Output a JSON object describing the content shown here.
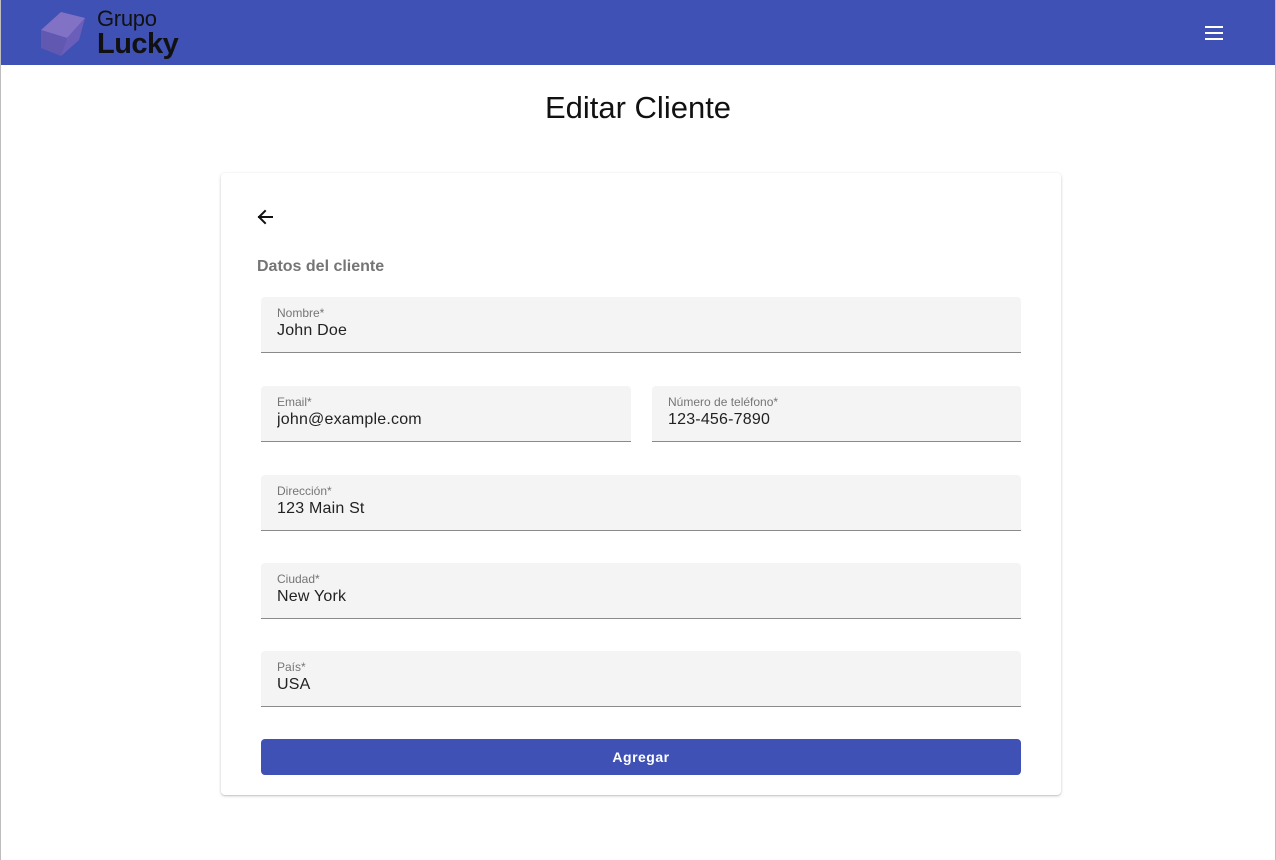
{
  "header": {
    "logo_line1": "Grupo",
    "logo_line2": "Lucky",
    "menu_icon": "menu-icon",
    "bar_color": "#3f51b5"
  },
  "page": {
    "title": "Editar Cliente"
  },
  "form": {
    "back_icon": "arrow-left-icon",
    "section_title": "Datos del cliente",
    "fields": {
      "nombre": {
        "label": "Nombre*",
        "value": "John Doe"
      },
      "email": {
        "label": "Email*",
        "value": "john@example.com"
      },
      "telefono": {
        "label": "Número de teléfono*",
        "value": "123-456-7890"
      },
      "direccion": {
        "label": "Dirección*",
        "value": "123 Main St"
      },
      "ciudad": {
        "label": "Ciudad*",
        "value": "New York"
      },
      "pais": {
        "label": "País*",
        "value": "USA"
      }
    },
    "submit_label": "Agregar",
    "accent_color": "#3f51b5"
  }
}
